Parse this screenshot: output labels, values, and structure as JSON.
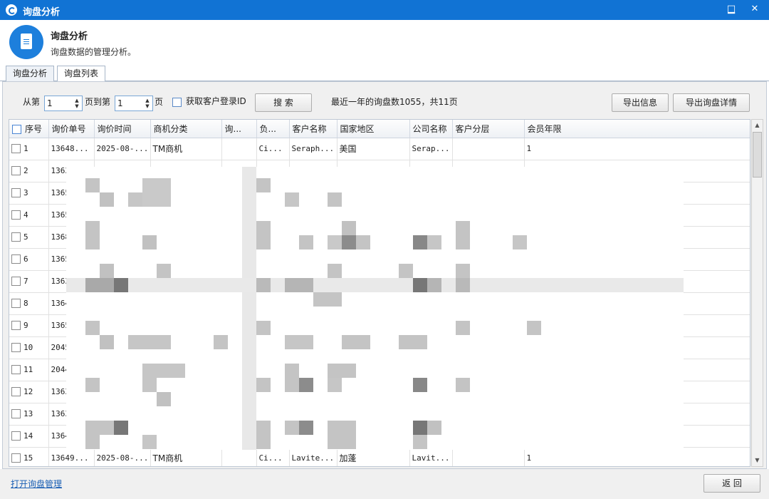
{
  "window": {
    "title": "询盘分析",
    "min_glyph": "▁",
    "max_glyph": "□",
    "close_glyph": "✕"
  },
  "header": {
    "title": "询盘分析",
    "subtitle": "询盘数据的管理分析。"
  },
  "tabs": [
    {
      "label": "询盘分析",
      "active": false
    },
    {
      "label": "询盘列表",
      "active": true
    }
  ],
  "toolbar": {
    "from_label": "从第",
    "from_value": "1",
    "to_label": "页到第",
    "to_value": "1",
    "page_suffix": "页",
    "login_id_label": "获取客户登录ID",
    "search_label": "搜 索",
    "summary": "最近一年的询盘数1055，共11页",
    "export_info_label": "导出信息",
    "export_detail_label": "导出询盘详情"
  },
  "table": {
    "columns": [
      "序号",
      "询价单号",
      "询价时间",
      "商机分类",
      "询...",
      "负...",
      "客户名称",
      "国家地区",
      "公司名称",
      "客户分层",
      "会员年限"
    ],
    "rows": [
      [
        "1",
        "13648...",
        "2025-08-...",
        "TM商机",
        "",
        "Ci...",
        "Seraph...",
        "美国",
        "Serap...",
        "",
        "1"
      ],
      [
        "2",
        "1363",
        "",
        "",
        "",
        "",
        "",
        "",
        "",
        "",
        ""
      ],
      [
        "3",
        "1365",
        "",
        "",
        "",
        "",
        "",
        "",
        "",
        "",
        ""
      ],
      [
        "4",
        "1365",
        "",
        "",
        "",
        "",
        "",
        "",
        "",
        "",
        ""
      ],
      [
        "5",
        "1368",
        "",
        "",
        "",
        "",
        "",
        "",
        "",
        "",
        ""
      ],
      [
        "6",
        "1365",
        "",
        "",
        "",
        "",
        "",
        "",
        "",
        "",
        ""
      ],
      [
        "7",
        "1363",
        "",
        "",
        "",
        "",
        "",
        "",
        "",
        "",
        ""
      ],
      [
        "8",
        "1364",
        "",
        "",
        "",
        "",
        "",
        "",
        "",
        "",
        ""
      ],
      [
        "9",
        "1365",
        "",
        "",
        "",
        "",
        "",
        "",
        "",
        "",
        ""
      ],
      [
        "10",
        "2045",
        "",
        "",
        "",
        "",
        "",
        "",
        "",
        "",
        ""
      ],
      [
        "11",
        "2044",
        "",
        "",
        "",
        "",
        "",
        "",
        "",
        "",
        ""
      ],
      [
        "12",
        "1363",
        "",
        "",
        "",
        "",
        "",
        "",
        "",
        "",
        ""
      ],
      [
        "13",
        "1363",
        "",
        "",
        "",
        "",
        "",
        "",
        "",
        "",
        ""
      ],
      [
        "14",
        "1364",
        "",
        "",
        "",
        "",
        "",
        "",
        "",
        "",
        ""
      ],
      [
        "15",
        "13649...",
        "2025-08-...",
        "TM商机",
        "",
        "Ci...",
        "Lavite...",
        "加蓬",
        "Lavit...",
        "",
        "1"
      ]
    ]
  },
  "footer": {
    "open_link": "打开询盘管理",
    "back_label": "返 回"
  },
  "colors": {
    "titlebar": "#1173d4",
    "link": "#1a5fb4",
    "logo": "#1d7fdc"
  },
  "icons": {
    "app": "app-logo-icon",
    "header": "document-icon"
  }
}
